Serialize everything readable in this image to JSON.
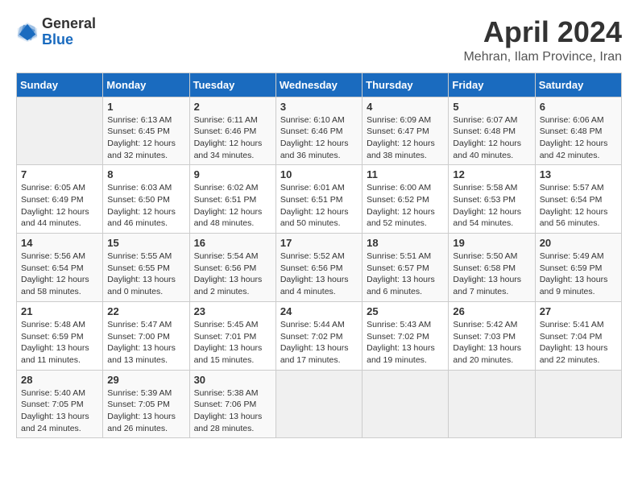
{
  "logo": {
    "line1": "General",
    "line2": "Blue"
  },
  "title": "April 2024",
  "location": "Mehran, Ilam Province, Iran",
  "weekdays": [
    "Sunday",
    "Monday",
    "Tuesday",
    "Wednesday",
    "Thursday",
    "Friday",
    "Saturday"
  ],
  "weeks": [
    [
      {
        "day": "",
        "sunrise": "",
        "sunset": "",
        "daylight": ""
      },
      {
        "day": "1",
        "sunrise": "Sunrise: 6:13 AM",
        "sunset": "Sunset: 6:45 PM",
        "daylight": "Daylight: 12 hours and 32 minutes."
      },
      {
        "day": "2",
        "sunrise": "Sunrise: 6:11 AM",
        "sunset": "Sunset: 6:46 PM",
        "daylight": "Daylight: 12 hours and 34 minutes."
      },
      {
        "day": "3",
        "sunrise": "Sunrise: 6:10 AM",
        "sunset": "Sunset: 6:46 PM",
        "daylight": "Daylight: 12 hours and 36 minutes."
      },
      {
        "day": "4",
        "sunrise": "Sunrise: 6:09 AM",
        "sunset": "Sunset: 6:47 PM",
        "daylight": "Daylight: 12 hours and 38 minutes."
      },
      {
        "day": "5",
        "sunrise": "Sunrise: 6:07 AM",
        "sunset": "Sunset: 6:48 PM",
        "daylight": "Daylight: 12 hours and 40 minutes."
      },
      {
        "day": "6",
        "sunrise": "Sunrise: 6:06 AM",
        "sunset": "Sunset: 6:48 PM",
        "daylight": "Daylight: 12 hours and 42 minutes."
      }
    ],
    [
      {
        "day": "7",
        "sunrise": "Sunrise: 6:05 AM",
        "sunset": "Sunset: 6:49 PM",
        "daylight": "Daylight: 12 hours and 44 minutes."
      },
      {
        "day": "8",
        "sunrise": "Sunrise: 6:03 AM",
        "sunset": "Sunset: 6:50 PM",
        "daylight": "Daylight: 12 hours and 46 minutes."
      },
      {
        "day": "9",
        "sunrise": "Sunrise: 6:02 AM",
        "sunset": "Sunset: 6:51 PM",
        "daylight": "Daylight: 12 hours and 48 minutes."
      },
      {
        "day": "10",
        "sunrise": "Sunrise: 6:01 AM",
        "sunset": "Sunset: 6:51 PM",
        "daylight": "Daylight: 12 hours and 50 minutes."
      },
      {
        "day": "11",
        "sunrise": "Sunrise: 6:00 AM",
        "sunset": "Sunset: 6:52 PM",
        "daylight": "Daylight: 12 hours and 52 minutes."
      },
      {
        "day": "12",
        "sunrise": "Sunrise: 5:58 AM",
        "sunset": "Sunset: 6:53 PM",
        "daylight": "Daylight: 12 hours and 54 minutes."
      },
      {
        "day": "13",
        "sunrise": "Sunrise: 5:57 AM",
        "sunset": "Sunset: 6:54 PM",
        "daylight": "Daylight: 12 hours and 56 minutes."
      }
    ],
    [
      {
        "day": "14",
        "sunrise": "Sunrise: 5:56 AM",
        "sunset": "Sunset: 6:54 PM",
        "daylight": "Daylight: 12 hours and 58 minutes."
      },
      {
        "day": "15",
        "sunrise": "Sunrise: 5:55 AM",
        "sunset": "Sunset: 6:55 PM",
        "daylight": "Daylight: 13 hours and 0 minutes."
      },
      {
        "day": "16",
        "sunrise": "Sunrise: 5:54 AM",
        "sunset": "Sunset: 6:56 PM",
        "daylight": "Daylight: 13 hours and 2 minutes."
      },
      {
        "day": "17",
        "sunrise": "Sunrise: 5:52 AM",
        "sunset": "Sunset: 6:56 PM",
        "daylight": "Daylight: 13 hours and 4 minutes."
      },
      {
        "day": "18",
        "sunrise": "Sunrise: 5:51 AM",
        "sunset": "Sunset: 6:57 PM",
        "daylight": "Daylight: 13 hours and 6 minutes."
      },
      {
        "day": "19",
        "sunrise": "Sunrise: 5:50 AM",
        "sunset": "Sunset: 6:58 PM",
        "daylight": "Daylight: 13 hours and 7 minutes."
      },
      {
        "day": "20",
        "sunrise": "Sunrise: 5:49 AM",
        "sunset": "Sunset: 6:59 PM",
        "daylight": "Daylight: 13 hours and 9 minutes."
      }
    ],
    [
      {
        "day": "21",
        "sunrise": "Sunrise: 5:48 AM",
        "sunset": "Sunset: 6:59 PM",
        "daylight": "Daylight: 13 hours and 11 minutes."
      },
      {
        "day": "22",
        "sunrise": "Sunrise: 5:47 AM",
        "sunset": "Sunset: 7:00 PM",
        "daylight": "Daylight: 13 hours and 13 minutes."
      },
      {
        "day": "23",
        "sunrise": "Sunrise: 5:45 AM",
        "sunset": "Sunset: 7:01 PM",
        "daylight": "Daylight: 13 hours and 15 minutes."
      },
      {
        "day": "24",
        "sunrise": "Sunrise: 5:44 AM",
        "sunset": "Sunset: 7:02 PM",
        "daylight": "Daylight: 13 hours and 17 minutes."
      },
      {
        "day": "25",
        "sunrise": "Sunrise: 5:43 AM",
        "sunset": "Sunset: 7:02 PM",
        "daylight": "Daylight: 13 hours and 19 minutes."
      },
      {
        "day": "26",
        "sunrise": "Sunrise: 5:42 AM",
        "sunset": "Sunset: 7:03 PM",
        "daylight": "Daylight: 13 hours and 20 minutes."
      },
      {
        "day": "27",
        "sunrise": "Sunrise: 5:41 AM",
        "sunset": "Sunset: 7:04 PM",
        "daylight": "Daylight: 13 hours and 22 minutes."
      }
    ],
    [
      {
        "day": "28",
        "sunrise": "Sunrise: 5:40 AM",
        "sunset": "Sunset: 7:05 PM",
        "daylight": "Daylight: 13 hours and 24 minutes."
      },
      {
        "day": "29",
        "sunrise": "Sunrise: 5:39 AM",
        "sunset": "Sunset: 7:05 PM",
        "daylight": "Daylight: 13 hours and 26 minutes."
      },
      {
        "day": "30",
        "sunrise": "Sunrise: 5:38 AM",
        "sunset": "Sunset: 7:06 PM",
        "daylight": "Daylight: 13 hours and 28 minutes."
      },
      {
        "day": "",
        "sunrise": "",
        "sunset": "",
        "daylight": ""
      },
      {
        "day": "",
        "sunrise": "",
        "sunset": "",
        "daylight": ""
      },
      {
        "day": "",
        "sunrise": "",
        "sunset": "",
        "daylight": ""
      },
      {
        "day": "",
        "sunrise": "",
        "sunset": "",
        "daylight": ""
      }
    ]
  ]
}
